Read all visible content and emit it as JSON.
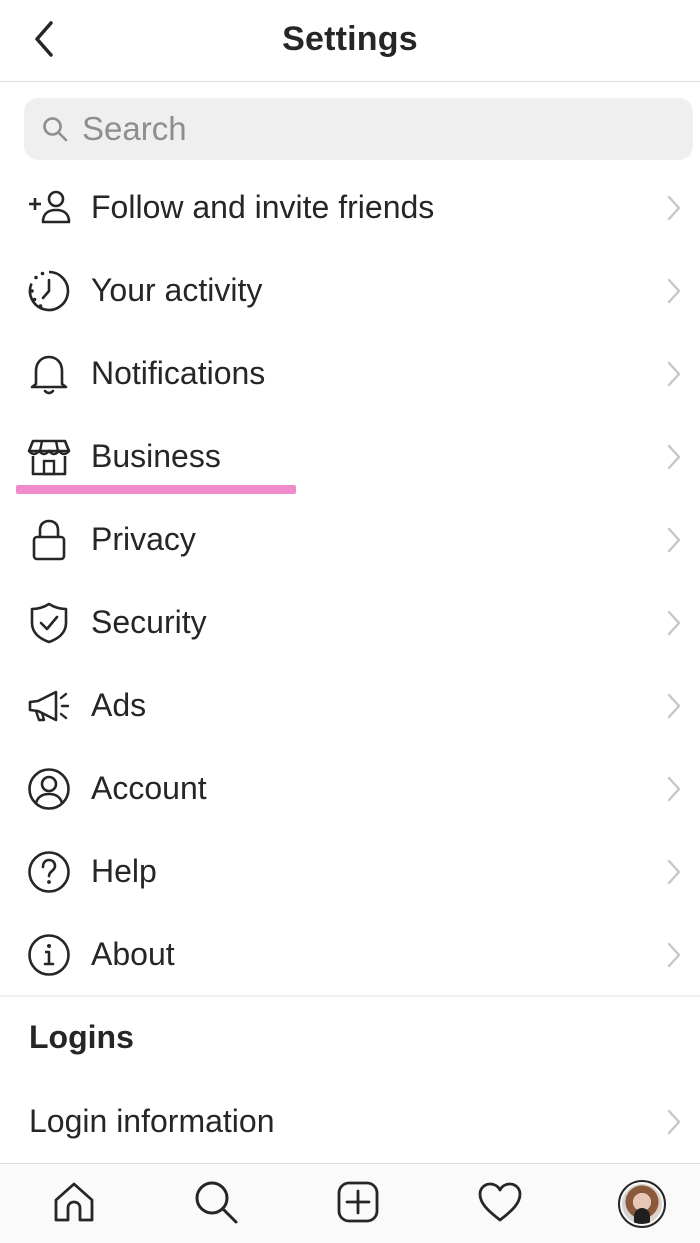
{
  "header": {
    "title": "Settings",
    "back_icon": "chevron-left-icon"
  },
  "search": {
    "placeholder": "Search",
    "icon": "search-icon"
  },
  "menu": {
    "items": [
      {
        "label": "Follow and invite friends",
        "icon": "add-person-icon"
      },
      {
        "label": "Your activity",
        "icon": "activity-clock-icon"
      },
      {
        "label": "Notifications",
        "icon": "bell-icon"
      },
      {
        "label": "Business",
        "icon": "storefront-icon"
      },
      {
        "label": "Privacy",
        "icon": "lock-icon"
      },
      {
        "label": "Security",
        "icon": "shield-check-icon"
      },
      {
        "label": "Ads",
        "icon": "megaphone-icon"
      },
      {
        "label": "Account",
        "icon": "account-circle-icon"
      },
      {
        "label": "Help",
        "icon": "help-circle-icon"
      },
      {
        "label": "About",
        "icon": "info-circle-icon"
      }
    ],
    "chevron_icon": "chevron-right-icon",
    "highlighted_item": "Business"
  },
  "logins": {
    "section_title": "Logins",
    "items": [
      {
        "label": "Login information"
      }
    ]
  },
  "tabbar": {
    "tabs": [
      {
        "name": "home",
        "icon": "home-icon"
      },
      {
        "name": "search",
        "icon": "search-icon"
      },
      {
        "name": "new-post",
        "icon": "plus-square-icon"
      },
      {
        "name": "activity",
        "icon": "heart-icon"
      },
      {
        "name": "profile",
        "icon": "avatar"
      }
    ]
  },
  "colors": {
    "highlight": "#f08ccb",
    "text": "#262626",
    "muted": "#8e8e8e",
    "chevron": "#c7c7c7",
    "search_bg": "#efefef",
    "divider": "#dbdbdb"
  }
}
